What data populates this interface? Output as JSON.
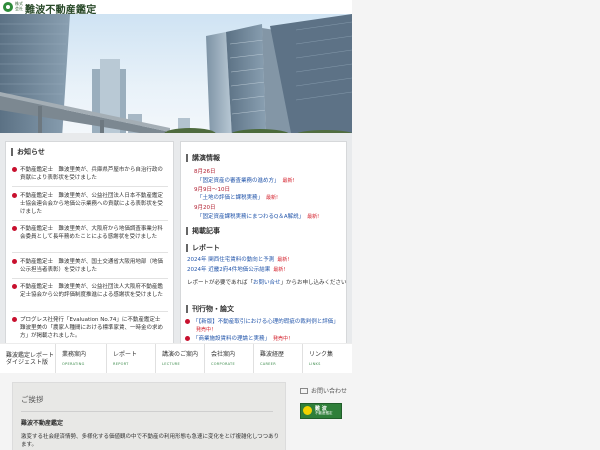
{
  "brand": {
    "small": "株式会社",
    "name": "難波不動産鑑定"
  },
  "news": {
    "title": "お知らせ",
    "items": [
      {
        "text": "不動産鑑定士　難波里美が、兵庫県芦屋市から自治行政の貢献により表彰状を受けました"
      },
      {
        "text": "不動産鑑定士　難波里美が、公益社団法人日本不動産鑑定士協会連合会から地価公示業務への貢献による表彰状を受けました"
      },
      {
        "text": "不動産鑑定士　難波里美が、大阪府から地価調査事業分科会委員として長年務めたことによる感謝状を受けました"
      },
      {
        "text": "不動産鑑定士　難波里美が、国土交通省大阪用地部（地価公示担当者表彰）を受けました"
      },
      {
        "text": "不動産鑑定士　難波里美が、公益社団法人大阪府不動産鑑定士協会から公的評価制度推進による感謝状を受けました"
      },
      {
        "text": "プログレス社発行「Evaluation No.74」に不動産鑑定士　難波里美の「農家人種間における標準家賃、一時金の求め方」が掲載されました。"
      }
    ]
  },
  "lectures": {
    "title": "講演情報",
    "items": [
      {
        "date": "8月26日",
        "link": "「固定資産の審査業務の進め方」",
        "badge": "最新!"
      },
      {
        "date": "9月9日～10日",
        "link": "「土地の評価と課税実務」",
        "badge": "最新!"
      },
      {
        "date": "9月20日",
        "link": "「固定資産課税実務にまつわるQ＆A解説」",
        "badge": "最新!"
      }
    ]
  },
  "articles": {
    "title": "掲載記事"
  },
  "reports": {
    "title": "レポート",
    "items": [
      {
        "link": "2024年 関西住宅賃料の動向と予測",
        "badge": "最新!"
      },
      {
        "link": "2024年 近畿2府4件地価公示結果",
        "badge": "最新!"
      }
    ],
    "note_pre": "レポートが必要であれば「",
    "note_link": "お問い合せ",
    "note_post": "」からお申し込みください"
  },
  "publications": {
    "title": "刊行物・論文",
    "items": [
      {
        "link": "「【新版】不動産取引における心理的瑕疵の裁判例と評価」",
        "badge": "発売中！"
      },
      {
        "link": "「商業施設賃料の理論と実務」",
        "badge": "発売中！"
      }
    ]
  },
  "nav": [
    {
      "jp": "難波鑑定レポート",
      "jp2": "ダイジェスト版",
      "en": ""
    },
    {
      "jp": "業務案内",
      "en": "OPERATING"
    },
    {
      "jp": "レポート",
      "en": "REPORT"
    },
    {
      "jp": "講演のご案内",
      "en": "LECTURE"
    },
    {
      "jp": "会社案内",
      "en": "CORPORATE"
    },
    {
      "jp": "難波経歴",
      "en": "CAREER"
    },
    {
      "jp": "リンク集",
      "en": "LINKS"
    }
  ],
  "greeting": {
    "title": "ご挨拶",
    "heading": "難波不動産鑑定",
    "body": "激変する社会経済情勢、多様化する価値観の中で不動産の利用形態も急速に変化をとげ複雑化しつつあります。"
  },
  "contact": {
    "label": "お問い合わせ"
  },
  "badge": {
    "line1": "難 波",
    "line2": "不動産鑑定"
  },
  "colors": {
    "accent_green": "#2e8b3a",
    "alert_red": "#c8102e",
    "link_blue": "#2255aa"
  }
}
